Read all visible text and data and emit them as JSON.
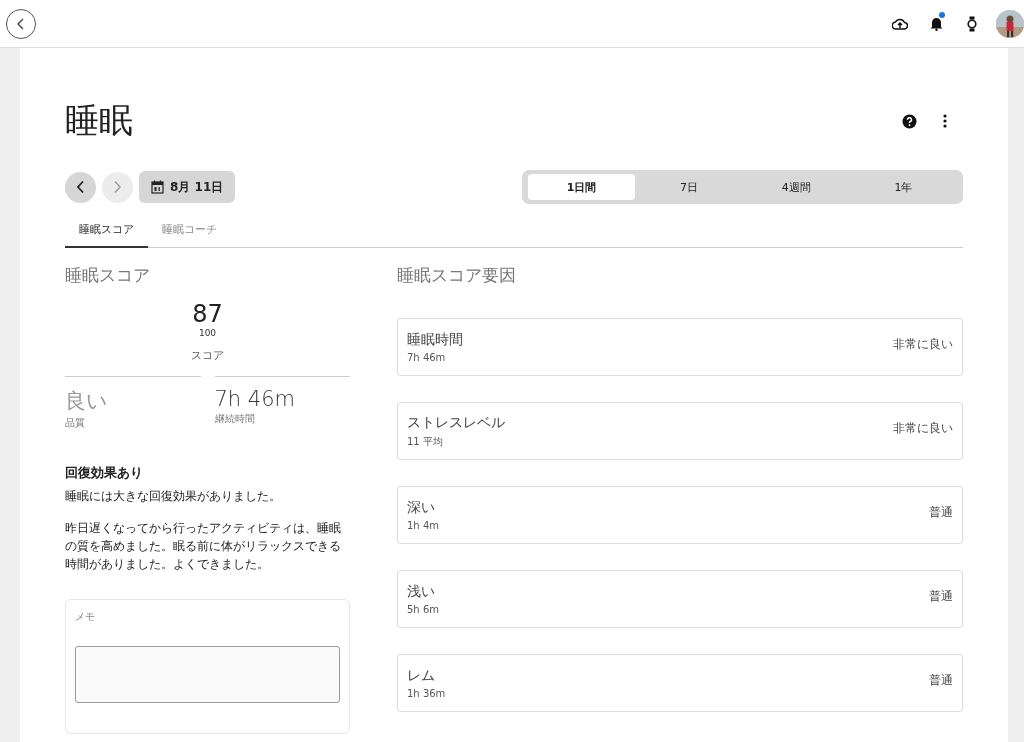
{
  "top_bar": {
    "notification_dot": true
  },
  "page": {
    "title": "睡眠"
  },
  "date_nav": {
    "prev_disabled": false,
    "next_disabled": true,
    "date": "8月 11日"
  },
  "ranges": [
    {
      "label": "1日間",
      "selected": true
    },
    {
      "label": "7日",
      "selected": false
    },
    {
      "label": "4週間",
      "selected": false
    },
    {
      "label": "1年",
      "selected": false
    }
  ],
  "tabs": [
    {
      "label": "睡眠スコア",
      "selected": true
    },
    {
      "label": "睡眠コーチ",
      "selected": false
    }
  ],
  "score": {
    "heading": "睡眠スコア",
    "value": "87",
    "max": "100",
    "label": "スコア",
    "stats": [
      {
        "value": "良い",
        "label": "品質",
        "kind": "light"
      },
      {
        "value": "7h 46m",
        "label": "継続時間",
        "kind": "dark"
      }
    ]
  },
  "insight": {
    "title": "回復効果あり",
    "paragraphs": [
      "睡眠には大きな回復効果がありました。",
      "昨日遅くなってから行ったアクティビティは、睡眠の質を高めました。眠る前に体がリラックスできる時間がありました。よくできました。"
    ]
  },
  "memo": {
    "label": "メモ"
  },
  "factors": {
    "heading": "睡眠スコア要因",
    "items": [
      {
        "name": "睡眠時間",
        "detail": "7h 46m",
        "rating": "非常に良い"
      },
      {
        "name": "ストレスレベル",
        "detail": "11 平均",
        "rating": "非常に良い"
      },
      {
        "name": "深い",
        "detail": "1h 4m",
        "rating": "普通"
      },
      {
        "name": "浅い",
        "detail": "5h 6m",
        "rating": "普通"
      },
      {
        "name": "レム",
        "detail": "1h 36m",
        "rating": "普通"
      }
    ]
  }
}
